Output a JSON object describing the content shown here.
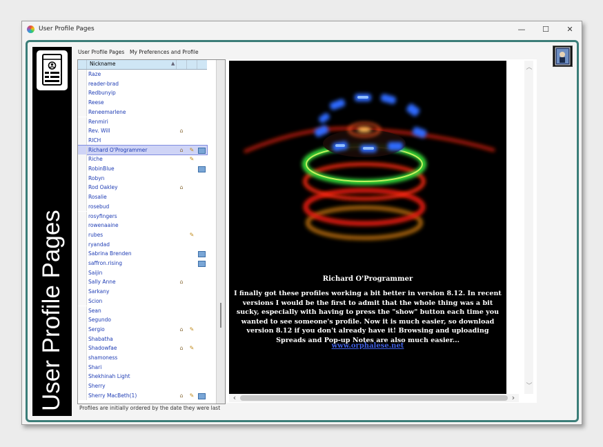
{
  "window": {
    "title": "User Profile Pages",
    "min": "—",
    "max": "☐",
    "close": "✕"
  },
  "banner": {
    "text": "User Profile Pages"
  },
  "tabs": [
    "User Profile Pages",
    "My Preferences and Profile"
  ],
  "list": {
    "header": "Nickname",
    "sort_arrow": "▲",
    "rows": [
      {
        "name": "Raze",
        "home": false,
        "pencil": false,
        "note": false,
        "selected": false
      },
      {
        "name": "reader-brad",
        "home": false,
        "pencil": false,
        "note": false,
        "selected": false
      },
      {
        "name": "Redbunyip",
        "home": false,
        "pencil": false,
        "note": false,
        "selected": false
      },
      {
        "name": "Reese",
        "home": false,
        "pencil": false,
        "note": false,
        "selected": false
      },
      {
        "name": "Reneemarlene",
        "home": false,
        "pencil": false,
        "note": false,
        "selected": false
      },
      {
        "name": "Renmiri",
        "home": false,
        "pencil": false,
        "note": false,
        "selected": false
      },
      {
        "name": "Rev. Will",
        "home": true,
        "pencil": false,
        "note": false,
        "selected": false
      },
      {
        "name": "RICH",
        "home": false,
        "pencil": false,
        "note": false,
        "selected": false
      },
      {
        "name": "Richard O'Programmer",
        "home": true,
        "pencil": true,
        "note": true,
        "selected": true
      },
      {
        "name": "Riche",
        "home": false,
        "pencil": true,
        "note": false,
        "selected": false
      },
      {
        "name": "RobinBlue",
        "home": false,
        "pencil": false,
        "note": true,
        "selected": false
      },
      {
        "name": "Robyn",
        "home": false,
        "pencil": false,
        "note": false,
        "selected": false
      },
      {
        "name": "Rod Oakley",
        "home": true,
        "pencil": false,
        "note": false,
        "selected": false
      },
      {
        "name": "Rosalie",
        "home": false,
        "pencil": false,
        "note": false,
        "selected": false
      },
      {
        "name": "rosebud",
        "home": false,
        "pencil": false,
        "note": false,
        "selected": false
      },
      {
        "name": "rosyfingers",
        "home": false,
        "pencil": false,
        "note": false,
        "selected": false
      },
      {
        "name": "rowenaaine",
        "home": false,
        "pencil": false,
        "note": false,
        "selected": false
      },
      {
        "name": "rubes",
        "home": false,
        "pencil": true,
        "note": false,
        "selected": false
      },
      {
        "name": "ryandad",
        "home": false,
        "pencil": false,
        "note": false,
        "selected": false
      },
      {
        "name": "Sabrina Brenden",
        "home": false,
        "pencil": false,
        "note": true,
        "selected": false
      },
      {
        "name": "saffron.rising",
        "home": false,
        "pencil": false,
        "note": true,
        "selected": false
      },
      {
        "name": "Saijin",
        "home": false,
        "pencil": false,
        "note": false,
        "selected": false
      },
      {
        "name": "Sally Anne",
        "home": true,
        "pencil": false,
        "note": false,
        "selected": false
      },
      {
        "name": "Sarkany",
        "home": false,
        "pencil": false,
        "note": false,
        "selected": false
      },
      {
        "name": "Scion",
        "home": false,
        "pencil": false,
        "note": false,
        "selected": false
      },
      {
        "name": "Sean",
        "home": false,
        "pencil": false,
        "note": false,
        "selected": false
      },
      {
        "name": "Segundo",
        "home": false,
        "pencil": false,
        "note": false,
        "selected": false
      },
      {
        "name": "Sergio",
        "home": true,
        "pencil": true,
        "note": false,
        "selected": false
      },
      {
        "name": "Shabatha",
        "home": false,
        "pencil": false,
        "note": false,
        "selected": false
      },
      {
        "name": "Shadowfae",
        "home": true,
        "pencil": true,
        "note": false,
        "selected": false
      },
      {
        "name": "shamoness",
        "home": false,
        "pencil": false,
        "note": false,
        "selected": false
      },
      {
        "name": "Shari",
        "home": false,
        "pencil": false,
        "note": false,
        "selected": false
      },
      {
        "name": "Shekhinah Light",
        "home": false,
        "pencil": false,
        "note": false,
        "selected": false
      },
      {
        "name": "Sherry",
        "home": false,
        "pencil": false,
        "note": false,
        "selected": false
      },
      {
        "name": "Sherry MacBeth(1)",
        "home": true,
        "pencil": true,
        "note": true,
        "selected": false
      }
    ]
  },
  "status": "Profiles are initially ordered by the date they were last",
  "profile": {
    "name": "Richard O'Programmer",
    "description": "I finally got these profiles working a bit better in version 8.12. In recent versions I would be the first to admit that the whole thing was a bit sucky, especially with having to press the \"show\" button each time you wanted to see someone's profile. Now it is much easier, so download version 8.12 if you don't already have it! Browsing and uploading Spreads and Pop-up Notes are also much easier...",
    "link": "www.orphalese.net"
  },
  "icons": {
    "home": "⌂",
    "pencil": "✎",
    "up": "︿",
    "down": "﹀",
    "left": "‹",
    "right": "›"
  },
  "colors": {
    "frame": "#3b7d78",
    "link": "#1e3cb4",
    "header": "#cfe6f5",
    "selected": "#cfd4f6"
  }
}
